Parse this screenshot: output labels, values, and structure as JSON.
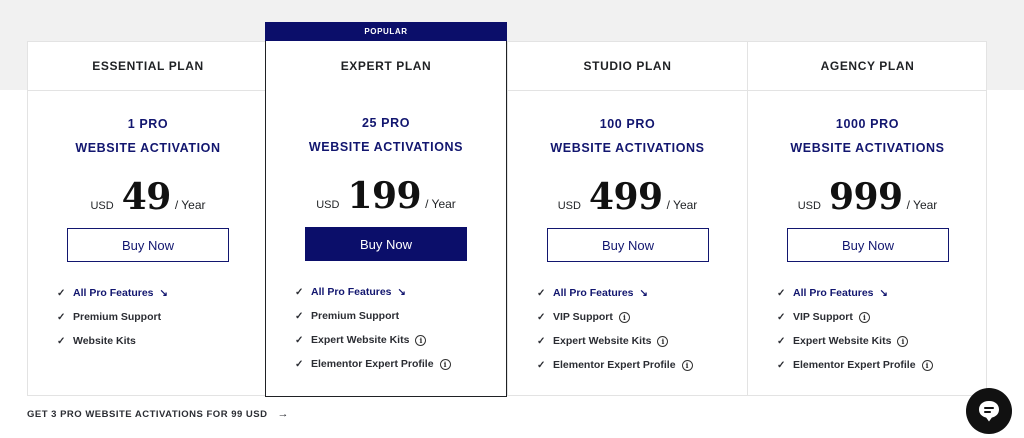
{
  "plans": [
    {
      "name": "ESSENTIAL PLAN",
      "activations_line1": "1 PRO",
      "activations_line2": "WEBSITE ACTIVATION",
      "currency": "USD",
      "price": "49",
      "period": "/ Year",
      "buy_label": "Buy Now",
      "features": [
        {
          "text": "All Pro Features",
          "icon": "arrow-down-right-icon"
        },
        {
          "text": "Premium Support"
        },
        {
          "text": "Website Kits"
        }
      ]
    },
    {
      "name": "EXPERT PLAN",
      "badge": "POPULAR",
      "activations_line1": "25 PRO",
      "activations_line2": "WEBSITE ACTIVATIONS",
      "currency": "USD",
      "price": "199",
      "period": "/ Year",
      "buy_label": "Buy Now",
      "features": [
        {
          "text": "All Pro Features",
          "icon": "arrow-down-right-icon"
        },
        {
          "text": "Premium Support"
        },
        {
          "text": "Expert Website Kits",
          "icon": "info-icon"
        },
        {
          "text": "Elementor Expert Profile",
          "icon": "info-icon"
        }
      ]
    },
    {
      "name": "STUDIO PLAN",
      "activations_line1": "100 PRO",
      "activations_line2": "WEBSITE ACTIVATIONS",
      "currency": "USD",
      "price": "499",
      "period": "/ Year",
      "buy_label": "Buy Now",
      "features": [
        {
          "text": "All Pro Features",
          "icon": "arrow-down-right-icon"
        },
        {
          "text": "VIP Support",
          "icon": "info-icon"
        },
        {
          "text": "Expert Website Kits",
          "icon": "info-icon"
        },
        {
          "text": "Elementor Expert Profile",
          "icon": "info-icon"
        }
      ]
    },
    {
      "name": "AGENCY PLAN",
      "activations_line1": "1000 PRO",
      "activations_line2": "WEBSITE ACTIVATIONS",
      "currency": "USD",
      "price": "999",
      "period": "/ Year",
      "buy_label": "Buy Now",
      "features": [
        {
          "text": "All Pro Features",
          "icon": "arrow-down-right-icon"
        },
        {
          "text": "VIP Support",
          "icon": "info-icon"
        },
        {
          "text": "Expert Website Kits",
          "icon": "info-icon"
        },
        {
          "text": "Elementor Expert Profile",
          "icon": "info-icon"
        }
      ]
    }
  ],
  "footer_link": {
    "label": "GET 3 PRO WEBSITE ACTIVATIONS FOR 99 USD",
    "icon": "arrow-right-icon"
  },
  "chat_button": {
    "icon": "chat-bubble-icon"
  },
  "colors": {
    "accent": "#12166f",
    "accent_filled": "#0b0e6a",
    "band": "#f1f1f1",
    "border": "#e3e3e3"
  }
}
